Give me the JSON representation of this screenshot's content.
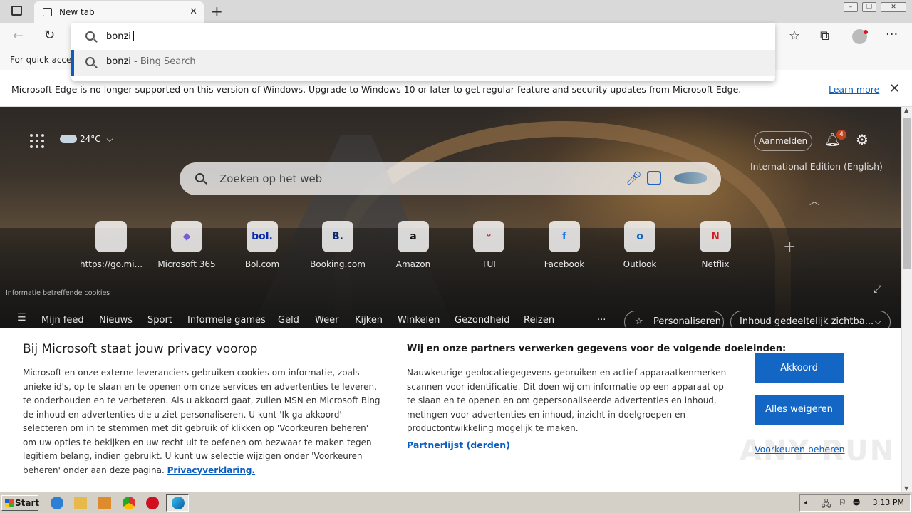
{
  "tab": {
    "title": "New tab"
  },
  "omnibox": {
    "query": "bonzi",
    "suggestion_term": "bonzi",
    "suggestion_source": " - Bing Search"
  },
  "bookmarks": {
    "hint": "For quick access"
  },
  "infobar": {
    "message": "Microsoft Edge is no longer supported on this version of Windows. Upgrade to Windows 10 or later to get regular feature and security updates from Microsoft Edge.",
    "learn_more": "Learn more"
  },
  "hero": {
    "temperature": "24°C",
    "signin": "Aanmelden",
    "notifications_count": "4",
    "edition": "International Edition (English)",
    "search_placeholder": "Zoeken op het web",
    "cookies_note": "Informatie betreffende cookies",
    "tiles": [
      {
        "label": "https://go.mi...",
        "glyph": "",
        "color": "#999999"
      },
      {
        "label": "Microsoft 365",
        "glyph": "◆",
        "color": "#7a5cd6"
      },
      {
        "label": "Bol.com",
        "glyph": "bol.",
        "color": "#0b2aa8"
      },
      {
        "label": "Booking.com",
        "glyph": "B.",
        "color": "#0b2a6e"
      },
      {
        "label": "Amazon",
        "glyph": "a",
        "color": "#111111"
      },
      {
        "label": "TUI",
        "glyph": "ᵕ",
        "color": "#d81e2c"
      },
      {
        "label": "Facebook",
        "glyph": "f",
        "color": "#1877f2"
      },
      {
        "label": "Outlook",
        "glyph": "o",
        "color": "#0a64c8"
      },
      {
        "label": "Netflix",
        "glyph": "N",
        "color": "#d11a22"
      }
    ],
    "feed_nav": [
      "Mijn feed",
      "Nieuws",
      "Sport",
      "Informele games",
      "Geld",
      "Weer",
      "Kijken",
      "Winkelen",
      "Gezondheid",
      "Reizen",
      "···"
    ],
    "personalize": "Personaliseren",
    "content_visibility": "Inhoud gedeeltelijk zichtba..."
  },
  "consent": {
    "title": "Bij Microsoft staat jouw privacy voorop",
    "body": "Microsoft en onze externe leveranciers gebruiken cookies om informatie, zoals unieke id's, op te slaan en te openen om onze services en advertenties te leveren, te onderhouden en te verbeteren. Als u akkoord gaat, zullen MSN en Microsoft Bing de inhoud en advertenties die u ziet personaliseren. U kunt 'Ik ga akkoord' selecteren om in te stemmen met dit gebruik of klikken op 'Voorkeuren beheren' om uw opties te bekijken en uw recht uit te oefenen om bezwaar te maken tegen legitiem belang, indien gebruikt. U kunt uw selectie wijzigen onder 'Voorkeuren beheren' onder aan deze pagina.",
    "privacy_link": "Privacyverklaring.",
    "purposes_title": "Wij en onze partners verwerken gegevens voor de volgende doeleinden:",
    "purposes_body": "Nauwkeurige geolocatiegegevens gebruiken en actief apparaatkenmerken scannen voor identificatie. Dit doen wij om informatie op een apparaat op te slaan en te openen en om gepersonaliseerde advertenties en inhoud, metingen voor advertenties en inhoud, inzicht in doelgroepen en productontwikkeling mogelijk te maken.",
    "partners_link": "Partnerlijst (derden)",
    "accept": "Akkoord",
    "reject": "Alles weigeren",
    "manage": "Voorkeuren beheren",
    "watermark": "ANY RUN"
  },
  "taskbar": {
    "start": "Start",
    "clock": "3:13 PM"
  }
}
